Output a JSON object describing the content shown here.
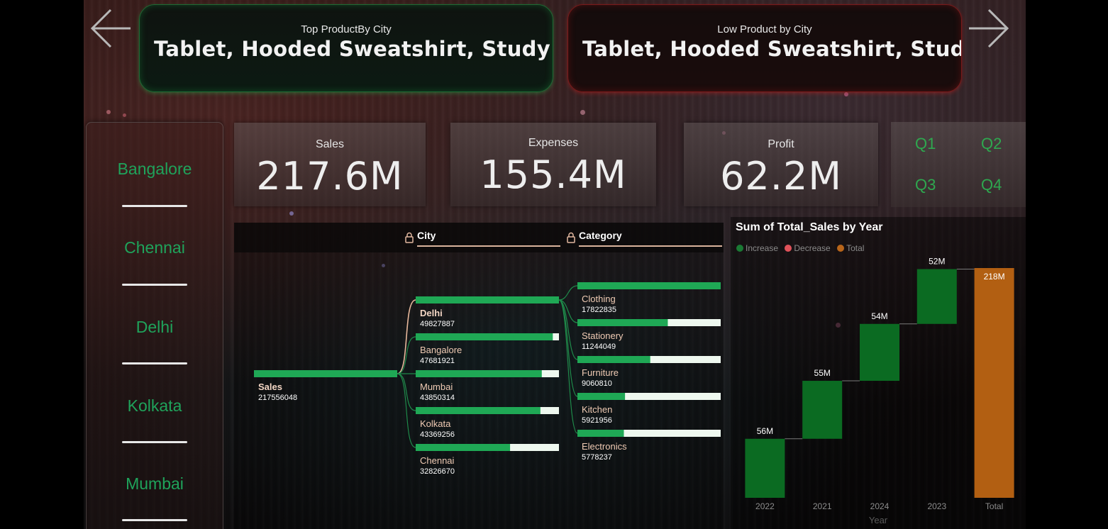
{
  "banners": {
    "top": {
      "label": "Top ProductBy City",
      "value": "Tablet, Hooded Sweatshirt, Study Des..."
    },
    "low": {
      "label": "Low Product by City",
      "value": "Tablet, Hooded Sweatshirt, Study..."
    }
  },
  "cities": [
    "Bangalore",
    "Chennai",
    "Delhi",
    "Kolkata",
    "Mumbai"
  ],
  "kpis": {
    "sales": {
      "label": "Sales",
      "value": "217.6M"
    },
    "expenses": {
      "label": "Expenses",
      "value": "155.4M"
    },
    "profit": {
      "label": "Profit",
      "value": "62.2M"
    }
  },
  "quarters": [
    "Q1",
    "Q2",
    "Q3",
    "Q4"
  ],
  "tree": {
    "headers": {
      "city": "City",
      "category": "Category"
    },
    "root": {
      "label": "Sales",
      "value": "217556048",
      "num": 217556048
    },
    "cities": [
      {
        "label": "Delhi",
        "value": "49827887",
        "num": 49827887,
        "selected": true
      },
      {
        "label": "Bangalore",
        "value": "47681921",
        "num": 47681921
      },
      {
        "label": "Mumbai",
        "value": "43850314",
        "num": 43850314
      },
      {
        "label": "Kolkata",
        "value": "43369256",
        "num": 43369256
      },
      {
        "label": "Chennai",
        "value": "32826670",
        "num": 32826670
      }
    ],
    "categories": [
      {
        "label": "Clothing",
        "value": "17822835",
        "num": 17822835
      },
      {
        "label": "Stationery",
        "value": "11244049",
        "num": 11244049
      },
      {
        "label": "Furniture",
        "value": "9060810",
        "num": 9060810
      },
      {
        "label": "Kitchen",
        "value": "5921956",
        "num": 5921956
      },
      {
        "label": "Electronics",
        "value": "5778237",
        "num": 5778237
      }
    ]
  },
  "waterfall": {
    "title": "Sum of Total_Sales by Year",
    "legend": [
      {
        "label": "Increase",
        "color": "#1a7a34"
      },
      {
        "label": "Decrease",
        "color": "#e0525a"
      },
      {
        "label": "Total",
        "color": "#b8651a"
      }
    ],
    "xlabel": "Year"
  },
  "colors": {
    "increase": "#0b6b22",
    "total": "#b25f12",
    "treeBar": "#1fa855",
    "treeTrack": "#eef8ef",
    "city": "#1fa35b",
    "quarter": "#2ea84f"
  },
  "chart_data": {
    "type": "bar",
    "subtype": "waterfall",
    "title": "Sum of Total_Sales by Year",
    "categories": [
      "2022",
      "2021",
      "2024",
      "2023",
      "Total"
    ],
    "values": [
      56,
      55,
      54,
      52,
      218
    ],
    "data_labels": [
      "56M",
      "55M",
      "54M",
      "52M",
      "218M"
    ],
    "unit": "M",
    "xlabel": "Year",
    "ylabel": "",
    "ylim": [
      0,
      218
    ]
  }
}
